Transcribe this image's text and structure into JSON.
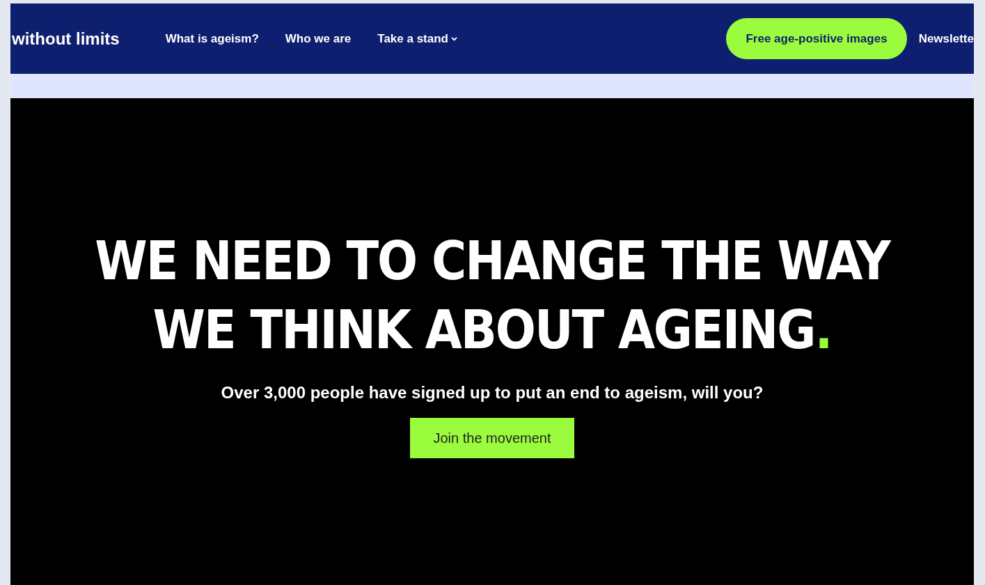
{
  "navbar": {
    "brand": "without limits",
    "links": [
      {
        "label": "What is ageism?",
        "dropdown": false
      },
      {
        "label": "Who we are",
        "dropdown": false
      },
      {
        "label": "Take a stand",
        "dropdown": true
      }
    ],
    "cta": "Free age-positive images",
    "trailing_link": "Newslette"
  },
  "hero": {
    "headline_lines": [
      "WE NEED TO CHANGE THE WAY",
      "WE THINK ABOUT AGEING"
    ],
    "headline_end": ".",
    "subtitle": "Over 3,000 people have signed up to put an end to ageism, will you?",
    "button": "Join the movement"
  }
}
